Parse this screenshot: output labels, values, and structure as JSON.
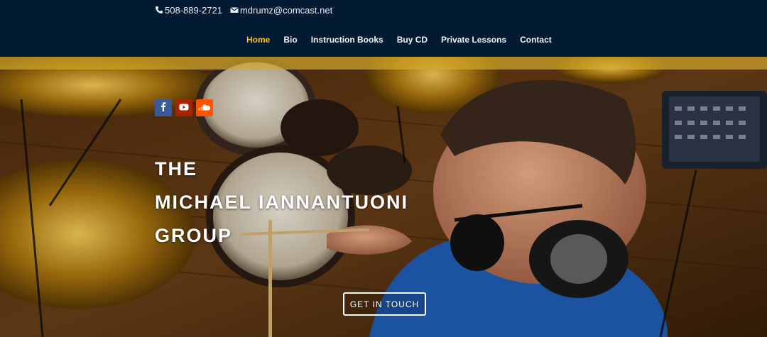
{
  "contact": {
    "phone": "508-889-2721",
    "email": "mdrumz@comcast.net",
    "phone_icon": "phone-icon",
    "email_icon": "envelope-icon"
  },
  "nav": {
    "items": [
      {
        "label": "Home",
        "active": true
      },
      {
        "label": "Bio",
        "active": false
      },
      {
        "label": "Instruction Books",
        "active": false
      },
      {
        "label": "Buy CD",
        "active": false
      },
      {
        "label": "Private Lessons",
        "active": false
      },
      {
        "label": "Contact",
        "active": false
      }
    ]
  },
  "social": [
    {
      "name": "facebook-icon",
      "color": "#3b5998"
    },
    {
      "name": "youtube-icon",
      "color": "#a82400"
    },
    {
      "name": "soundcloud-icon",
      "color": "#ff5500"
    }
  ],
  "hero": {
    "title_lines": [
      "THE",
      "MICHAEL IANNANTUONI",
      "GROUP"
    ],
    "cta_label": "GET IN TOUCH"
  },
  "colors": {
    "header_bg": "#031a33",
    "nav_active": "#f2c230",
    "nav_text": "#f1f4f8"
  }
}
